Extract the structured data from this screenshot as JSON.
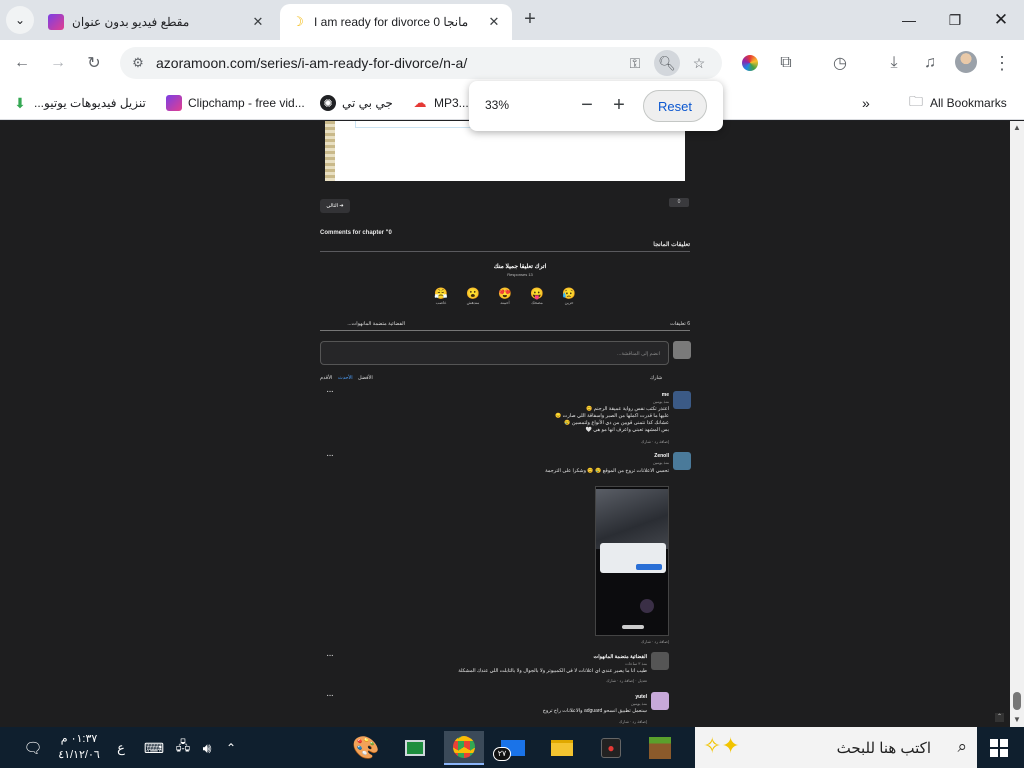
{
  "browser": {
    "tabs": [
      {
        "title": "مقطع فيديو بدون عنوان",
        "active": false
      },
      {
        "title": "مانجا I am ready for divorce 0",
        "active": true
      }
    ],
    "url": "azoramoon.com/series/i-am-ready-for-divorce/n-a/",
    "zoom": {
      "percent": "33%",
      "reset_label": "Reset",
      "minus": "−",
      "plus": "+"
    },
    "bookmarks": [
      {
        "label": "تنزيل فيديوهات يوتيو..."
      },
      {
        "label": "Clipchamp - free vid..."
      },
      {
        "label": "جي بي تي"
      },
      {
        "label": "MP3..."
      }
    ],
    "bookmarks_more": "»",
    "all_bookmarks": "All Bookmarks"
  },
  "page": {
    "next_label": "التالي ➔",
    "counter": "0",
    "comments_heading": "Comments for chapter \"0",
    "manga_comments_label": "تعليقات المانجا",
    "leave_comment_title": "اترك تعليقا جميلا منك",
    "responses": "Responses 13",
    "reactions": [
      {
        "emoji": "😥",
        "label": "حزين"
      },
      {
        "emoji": "😛",
        "label": "مضحك"
      },
      {
        "emoji": "😍",
        "label": "أحببته"
      },
      {
        "emoji": "😮",
        "label": "مندهش"
      },
      {
        "emoji": "😤",
        "label": "غاضب"
      }
    ],
    "comments_count": "6 تعليقات",
    "community": "الفضائية متضمة المانهوات...",
    "comment_placeholder": "انضم إلى المناقشة...",
    "sort": {
      "best": "الأفضل",
      "newest": "الأحدث",
      "oldest": "الأقدم"
    },
    "share": "شارك",
    "comments": [
      {
        "name": "me",
        "meta": "منذ يومين",
        "lines": [
          "اعتذر تكتب نفس رواية عميقة الرجنم 😊",
          "عليها ما قدرت اكملها من الصبر واسفاقة اللي صارت 😞",
          "عشانك كذا نتمنى قويين من دي الأنواع ولتمسين 😢",
          "بس المشهد تعبني واعرف انها مو هي 🤍"
        ],
        "actions": "إضافة رد · شارك"
      },
      {
        "name": "Zenoll",
        "meta": "منذ يومين",
        "lines": [
          "تحسي الاعلانات تروح من الموقع 😢 😊 وشكرا على الترجمة"
        ],
        "actions": "إضافة رد · شارك"
      },
      {
        "name": "الفضائية متضمة المانهوات",
        "meta": "منذ ٣ ساعات",
        "lines": [
          "طيب انا ما يصير عندي اي اعلانات لا في الكمبيوتر ولا بالجوال ولا بالتابلت اللي عندك المشكلة"
        ],
        "actions": "تعديل · إضافة رد · شارك"
      },
      {
        "name": "yutel",
        "meta": "منذ يومين",
        "lines": [
          "سنعمل تطبيق انسحو adguard والاعلانات راح تروح"
        ],
        "actions": "إضافة رد · شارك"
      }
    ],
    "dots": "···",
    "dash": "—"
  },
  "taskbar": {
    "search_placeholder": "اكتب هنا للبحث",
    "time": "٠١:٣٧ م",
    "date": "٤١/١٢/٠٦",
    "lang": "ع",
    "badge": "٢٧"
  },
  "colors": {
    "accent": "#0b57d0",
    "tab_bg": "#dfe3e8",
    "page_bg": "#1e1e1f",
    "taskbar": "#0f1f2e"
  }
}
